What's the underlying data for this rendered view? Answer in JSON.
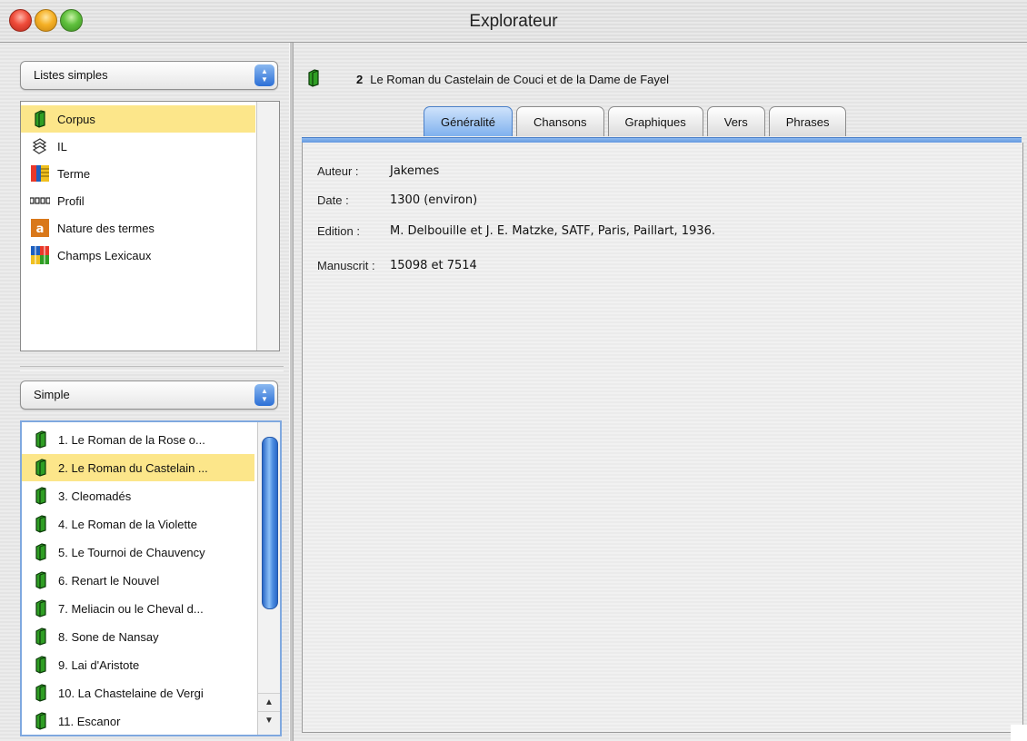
{
  "window": {
    "title": "Explorateur"
  },
  "left": {
    "top_popup": {
      "label": "Listes simples"
    },
    "top_items": [
      {
        "label": "Corpus",
        "icon": "book-icon",
        "selected": true
      },
      {
        "label": "IL",
        "icon": "pages-icon",
        "selected": false
      },
      {
        "label": "Terme",
        "icon": "terme-icon",
        "selected": false
      },
      {
        "label": "Profil",
        "icon": "profil-icon",
        "selected": false
      },
      {
        "label": "Nature des termes",
        "icon": "letter-a-icon",
        "selected": false
      },
      {
        "label": "Champs Lexicaux",
        "icon": "champs-icon",
        "selected": false
      }
    ],
    "bottom_popup": {
      "label": "Simple"
    },
    "bottom_items": [
      {
        "label": "1. Le Roman de la Rose o...",
        "selected": false
      },
      {
        "label": "2. Le Roman du Castelain ...",
        "selected": true
      },
      {
        "label": "3. Cleomadés",
        "selected": false
      },
      {
        "label": "4. Le Roman de la Violette",
        "selected": false
      },
      {
        "label": "5. Le Tournoi de Chauvency",
        "selected": false
      },
      {
        "label": "6. Renart le Nouvel",
        "selected": false
      },
      {
        "label": "7. Meliacin ou le Cheval d...",
        "selected": false
      },
      {
        "label": "8. Sone de Nansay",
        "selected": false
      },
      {
        "label": "9. Lai d'Aristote",
        "selected": false
      },
      {
        "label": "10. La Chastelaine de Vergi",
        "selected": false
      },
      {
        "label": "11. Escanor",
        "selected": false
      }
    ]
  },
  "detail": {
    "number": "2",
    "title": "Le Roman du Castelain de Couci et de la Dame de Fayel",
    "tabs": [
      {
        "label": "Généralité",
        "active": true
      },
      {
        "label": "Chansons",
        "active": false
      },
      {
        "label": "Graphiques",
        "active": false
      },
      {
        "label": "Vers",
        "active": false
      },
      {
        "label": "Phrases",
        "active": false
      }
    ],
    "fields": [
      {
        "key": "Auteur :",
        "value": "Jakemes"
      },
      {
        "key": "Date :",
        "value": "1300 (environ)"
      },
      {
        "key": "Edition :",
        "value": "M. Delbouille et J. E. Matzke, SATF, Paris, Paillart, 1936."
      },
      {
        "key": "Manuscrit :",
        "value": "15098 et 7514"
      }
    ]
  },
  "colors": {
    "selection": "#fce68a",
    "accent": "#2c6fd6"
  }
}
